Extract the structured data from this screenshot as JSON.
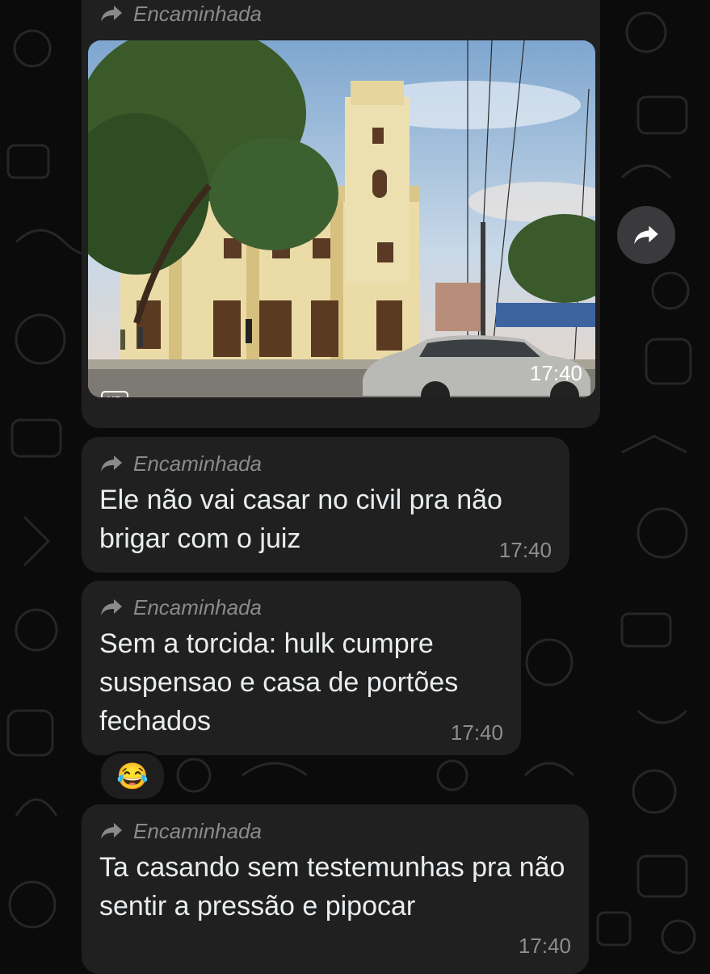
{
  "chat": {
    "forwarded_label": "Encaminhada",
    "photo_message": {
      "time": "17:40",
      "hd_label": "HD"
    },
    "messages": [
      {
        "text": "Ele não vai casar no civil pra não brigar com o juiz",
        "time": "17:40"
      },
      {
        "text": "Sem a torcida: hulk cumpre suspensao e casa de portões fechados",
        "time": "17:40",
        "reaction": "😂"
      },
      {
        "text": "Ta casando sem testemunhas pra não sentir a pressão e pipocar",
        "time": "17:40"
      }
    ]
  },
  "icons": {
    "forward": "forward-arrow-icon",
    "share": "share-icon"
  },
  "colors": {
    "background": "#0b0b0b",
    "bubble": "#202020",
    "meta_text": "#8e8e8e"
  }
}
